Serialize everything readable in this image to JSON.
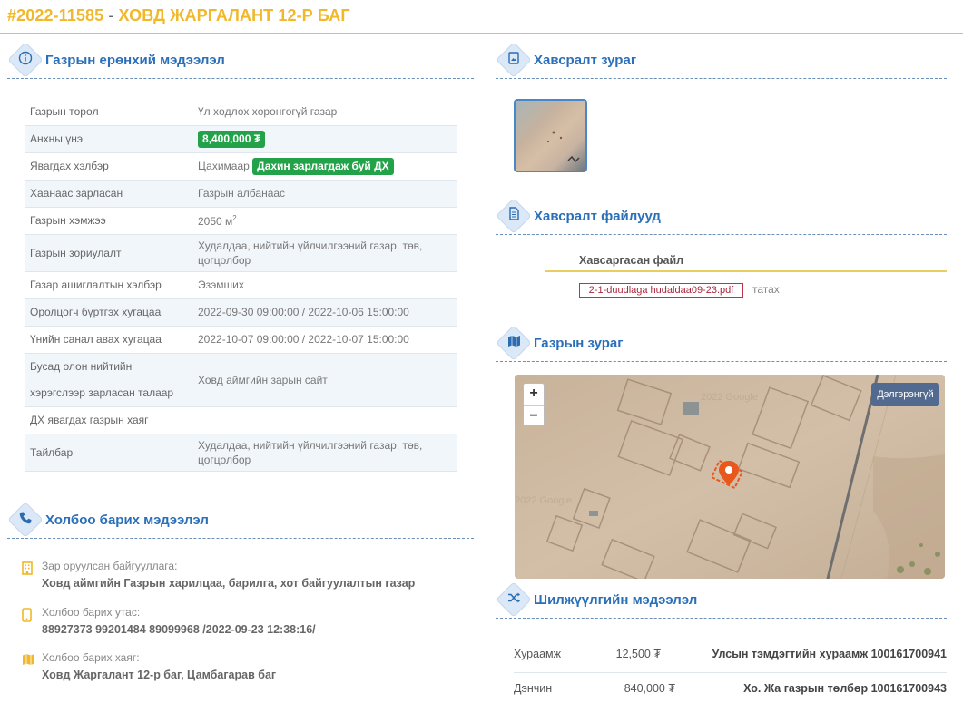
{
  "page": {
    "id": "#2022-11585",
    "separator": "-",
    "title": "ХОВД ЖАРГАЛАНТ 12-Р БАГ"
  },
  "sections": {
    "general": "Газрын ерөнхий мэдээлэл",
    "contact": "Холбоо барих мэдээлэл",
    "photo": "Хавсралт зураг",
    "files": "Хавсралт файлууд",
    "map": "Газрын зураг",
    "transfer": "Шилжүүлгийн мэдээлэл"
  },
  "info": {
    "land_type_label": "Газрын төрөл",
    "land_type_value": "Үл хөдлөх хөрөнгөгүй газар",
    "start_price_label": "Анхны үнэ",
    "start_price_value": "8,400,000 ₮",
    "method_label": "Явагдах хэлбэр",
    "method_value": "Цахимаар",
    "method_badge": "Дахин зарлагдаж буй ДХ",
    "announcer_label": "Хаанаас зарласан",
    "announcer_value": "Газрын албанаас",
    "size_label": "Газрын хэмжээ",
    "size_value": "2050 м",
    "size_unit_exp": "2",
    "purpose_label": "Газрын зориулалт",
    "purpose_value": "Худалдаа, нийтийн үйлчилгээний газар, төв, цогцолбор",
    "usage_label": "Газар ашиглалтын хэлбэр",
    "usage_value": "Эзэмших",
    "register_label": "Оролцогч бүртгэх хугацаа",
    "register_value": "2022-09-30 09:00:00 / 2022-10-06 15:00:00",
    "offer_label": "Үнийн санал авах хугацаа",
    "offer_value": "2022-10-07 09:00:00 / 2022-10-07 15:00:00",
    "media_label": "Бусад олон нийтийн хэрэгслээр зарласан талаар",
    "media_value": "Ховд аймгийн зарын сайт",
    "address_label": "ДХ явагдах газрын хаяг",
    "address_value": "",
    "note_label": "Тайлбар",
    "note_value": "Худалдаа, нийтийн үйлчилгээний газар, төв, цогцолбор"
  },
  "contact": {
    "org_label": "Зар оруулсан байгууллага:",
    "org_value": "Ховд аймгийн Газрын харилцаа, барилга, хот байгуулалтын газар",
    "phone_label": "Холбоо барих утас:",
    "phone_value": "88927373 99201484 89099968 /2022-09-23 12:38:16/",
    "addr_label": "Холбоо барих хаяг:",
    "addr_value": "Ховд Жаргалант 12-р баг, Цамбагарав баг"
  },
  "files": {
    "header": "Хавсаргасан файл",
    "file_name": "2-1-duudlaga hudaldaa09-23.pdf",
    "download": "татах"
  },
  "map": {
    "zoom_in": "+",
    "zoom_out": "−",
    "expand": "Дэлгэрэнгүй",
    "watermark": "2022 Google"
  },
  "transfer": [
    {
      "name": "Хураамж",
      "amount": "12,500 ₮",
      "destination": "Улсын тэмдэгтийн хураамж 100161700941"
    },
    {
      "name": "Дэнчин",
      "amount": "840,000 ₮",
      "destination": "Хо. Жа газрын төлбөр 100161700943"
    }
  ],
  "colors": {
    "title": "#f0b82a",
    "section_title": "#2a6fb8",
    "badge": "#24a24a",
    "file_link": "#a8283c",
    "map_pin": "#e8581c"
  },
  "icons": {
    "general": "info-icon",
    "contact": "phone-icon",
    "photo": "image-icon",
    "files": "file-icon",
    "map": "map-icon",
    "transfer": "shuffle-icon"
  }
}
